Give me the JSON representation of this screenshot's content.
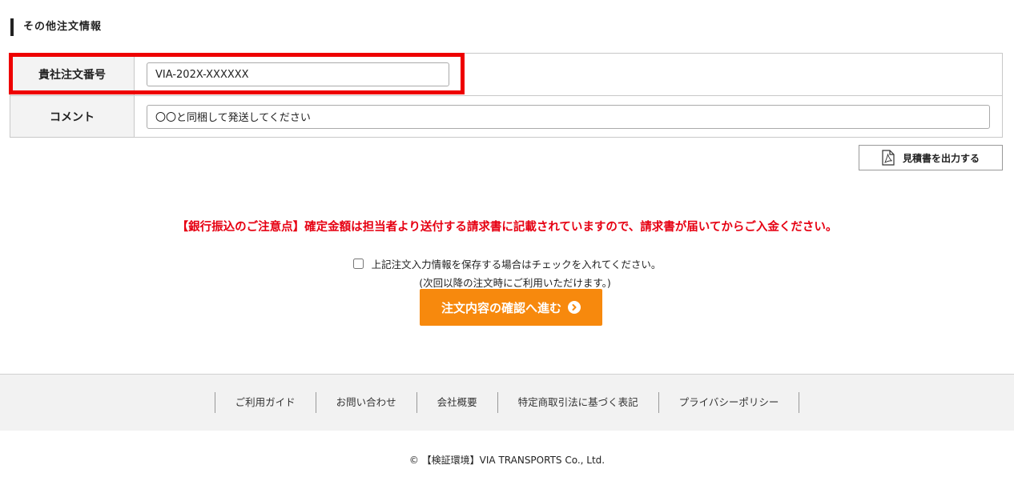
{
  "section": {
    "title": "その他注文情報"
  },
  "form": {
    "order_number": {
      "label": "貴社注文番号",
      "value": "VIA-202X-XXXXXX"
    },
    "comment": {
      "label": "コメント",
      "value": "〇〇と同梱して発送してください"
    }
  },
  "quote_button": {
    "label": "見積書を出力する",
    "icon": "pdf-icon"
  },
  "notice": "【銀行振込のご注意点】確定金額は担当者より送付する請求書に記載されていますので、請求書が届いてからご入金ください。",
  "save_option": {
    "label": "上記注文入力情報を保存する場合はチェックを入れてください。",
    "note": "(次回以降の注文時にご利用いただけます。)",
    "checked": false
  },
  "proceed_button": {
    "label": "注文内容の確認へ進む",
    "icon": "arrow-right-circle-icon"
  },
  "footer": {
    "links": [
      "ご利用ガイド",
      "お問い合わせ",
      "会社概要",
      "特定商取引法に基づく表記",
      "プライバシーポリシー"
    ],
    "copyright": "© 【検証環境】VIA TRANSPORTS Co., Ltd."
  },
  "colors": {
    "highlight": "#ee0000",
    "notice": "#e60012",
    "proceed_button": "#f7890d"
  }
}
